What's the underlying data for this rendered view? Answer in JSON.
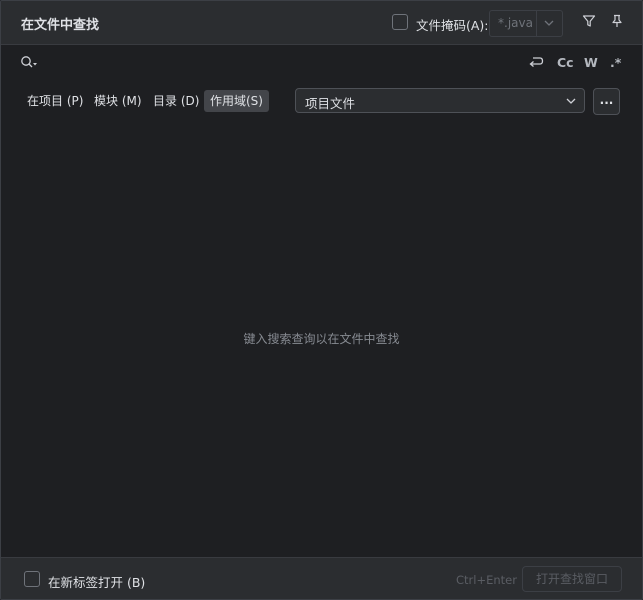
{
  "header": {
    "title": "在文件中查找",
    "file_mask_label": "文件掩码(A):",
    "file_mask_value": "*.java",
    "file_mask_checked": false,
    "filter_icon": "filter-icon",
    "pin_icon": "pin-icon"
  },
  "search": {
    "query": "",
    "search_icon": "search-history-icon",
    "options": {
      "newline_icon": "newline-icon",
      "match_case": "Cc",
      "words": "W",
      "regex": ".*"
    }
  },
  "scope": {
    "tabs": [
      {
        "label": "在项目 (P)",
        "active": false
      },
      {
        "label": "模块 (M)",
        "active": false
      },
      {
        "label": "目录 (D)",
        "active": false
      },
      {
        "label": "作用域(S)",
        "active": true
      }
    ],
    "selected_scope": "项目文件",
    "more_label": "..."
  },
  "results": {
    "empty_text": "键入搜索查询以在文件中查找"
  },
  "footer": {
    "open_in_new_tab_label": "在新标签打开 (B)",
    "open_in_new_tab_checked": false,
    "shortcut": "Ctrl+Enter",
    "open_window_label": "打开查找窗口"
  },
  "colors": {
    "window_bg": "#2b2d30",
    "panel_bg": "#1e1f22",
    "text": "#dfe1e5",
    "muted": "#868a91",
    "disabled": "#5a5d63"
  }
}
